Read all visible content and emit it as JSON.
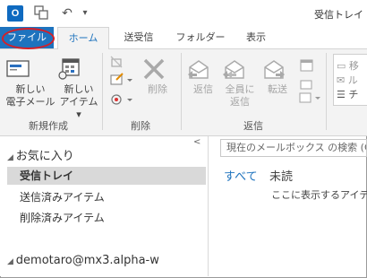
{
  "window_title": "受信トレイ",
  "tabs": [
    {
      "label": "ファイル"
    },
    {
      "label": "ホーム"
    },
    {
      "label": "送受信"
    },
    {
      "label": "フォルダー"
    },
    {
      "label": "表示"
    }
  ],
  "ribbon": {
    "new_group": {
      "label": "新規作成",
      "new_mail": {
        "line1": "新しい",
        "line2": "電子メール"
      },
      "new_items": {
        "line1": "新しい",
        "line2": "アイテム",
        "arrow": "▾"
      }
    },
    "delete_group": {
      "label": "削除",
      "delete": "削除"
    },
    "respond_group": {
      "label": "返信",
      "reply": "返信",
      "reply_all": {
        "line1": "全員に",
        "line2": "返信"
      },
      "forward": "転送"
    },
    "partial_labels": [
      "移",
      "ル",
      "チ"
    ]
  },
  "navigation": {
    "favorites_header": "お気に入り",
    "collapse_glyph": "<",
    "items": [
      "受信トレイ",
      "送信済みアイテム",
      "削除済みアイテム"
    ],
    "account": "demotaro@mx3.alpha-w"
  },
  "messages": {
    "search_placeholder": "現在のメールボックス の検索 (Ct",
    "filter_all": "すべて",
    "filter_unread": "未読",
    "empty_message": "ここに表示するアイテム"
  },
  "colors": {
    "accent": "#1e73be",
    "highlight_ring": "#d61f26"
  }
}
